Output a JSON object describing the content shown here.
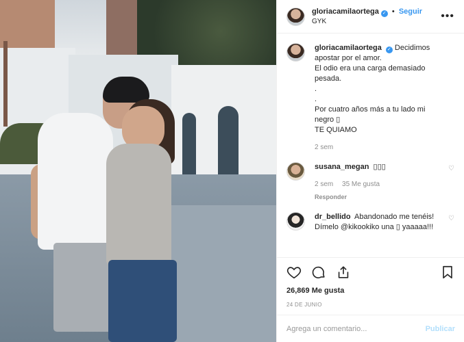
{
  "post": {
    "author": "gloriacamilaortega",
    "follow_label": "Seguir",
    "separator": "•",
    "location": "GYK",
    "more_label": "•••"
  },
  "caption": {
    "username": "gloriacamilaortega",
    "text": "Decidimos apostar por el amor.\nEl odio era una carga demasiado pesada.\n.\n.\nPor cuatro años más a tu lado mi negro ▯\nTE QUIAMO",
    "time": "2 sem"
  },
  "comments": [
    {
      "username": "susana_megan",
      "text": "▯▯▯",
      "time": "2 sem",
      "likes": "35 Me gusta",
      "reply": "Responder"
    },
    {
      "username": "dr_bellido",
      "text": "Abandonado me tenéis! Dímelo @kikookiko una ▯ yaaaaa!!!"
    }
  ],
  "stats": {
    "likes": "26,869 Me gusta",
    "date": "24 DE JUNIO"
  },
  "add_comment": {
    "placeholder": "Agrega un comentario...",
    "publish": "Publicar"
  },
  "colors": {
    "accent": "#3897f0",
    "muted": "#8e8e8e",
    "publish_disabled": "#b2dffc"
  },
  "icons": [
    "verified-badge-icon",
    "heart-icon",
    "comment-icon",
    "share-icon",
    "bookmark-icon",
    "more-options-icon"
  ]
}
